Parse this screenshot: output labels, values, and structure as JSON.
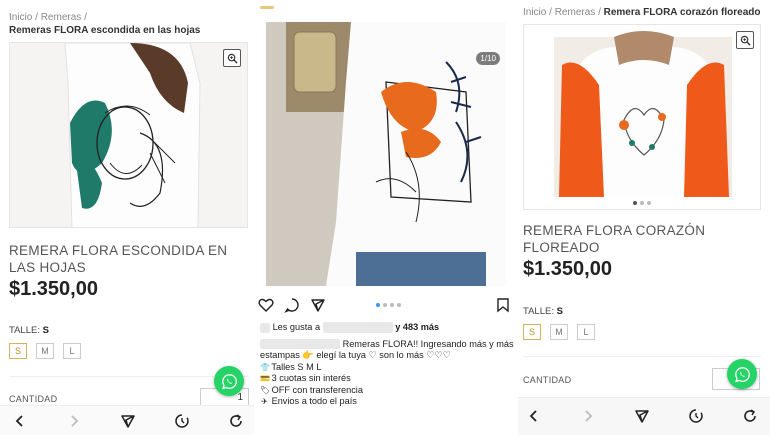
{
  "panel1": {
    "breadcrumb": {
      "home": "Inicio",
      "sep1": "/",
      "section": "Remeras",
      "sep2": "/",
      "current": "Remeras FLORA escondida en las hojas"
    },
    "zoom_icon": "zoom-icon",
    "title": "REMERA FLORA ESCONDIDA EN LAS HOJAS",
    "price": "$1.350,00",
    "size_label": "TALLE:",
    "size_selected": "S",
    "sizes": [
      "S",
      "M",
      "L"
    ],
    "quantity_label": "CANTIDAD",
    "quantity_value": "1"
  },
  "panel2": {
    "image_counter": "1/10",
    "likes_prefix": "Les gusta a",
    "likes_suffix": "y 483 más",
    "caption_line1": "Remeras FLORA!! Ingresando más y más",
    "caption_line2": "estampas 👉 elegí la tuya ♡ son lo más ♡♡♡",
    "bullets": [
      {
        "icon": "shirt-icon",
        "text": "Talles S M L"
      },
      {
        "icon": "card-icon",
        "text": "3 cuotas sin interés"
      },
      {
        "icon": "tag-icon",
        "text": "OFF con transferencia"
      },
      {
        "icon": "plane-icon",
        "text": "Envios a todo el país"
      }
    ]
  },
  "panel3": {
    "breadcrumb": {
      "home": "Inicio",
      "sep1": "/",
      "section": "Remeras",
      "sep2": "/",
      "current": "Remera FLORA corazón floreado"
    },
    "title_line1": "REMERA FLORA CORAZÓN",
    "title_line2": "FLOREADO",
    "price": "$1.350,00",
    "size_label": "TALLE:",
    "size_selected": "S",
    "sizes": [
      "S",
      "M",
      "L"
    ],
    "quantity_label": "CANTIDAD"
  },
  "colors": {
    "whatsapp": "#25d366",
    "selected_size": "#c08a2b",
    "orange_flower": "#e86a1c",
    "teal_leaf": "#1f7a6a"
  }
}
